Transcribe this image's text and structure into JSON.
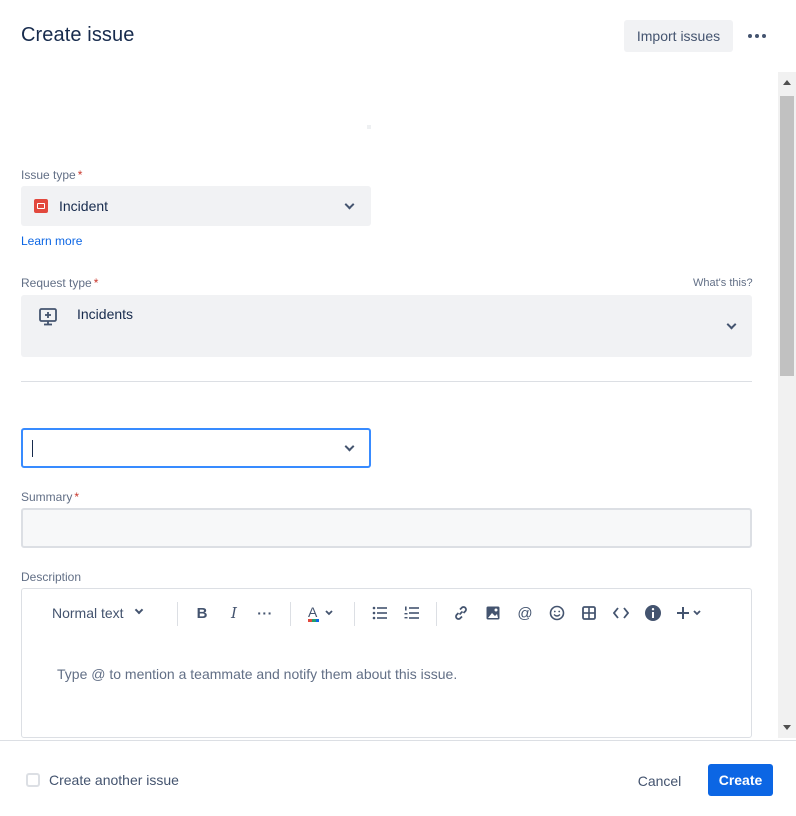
{
  "header": {
    "title": "Create issue",
    "import_label": "Import issues",
    "more_icon": "ellipsis-icon"
  },
  "issue_type": {
    "label": "Issue type",
    "required_mark": "*",
    "value": "Incident",
    "icon": "incident-icon",
    "learn_more": "Learn more"
  },
  "request_type": {
    "label": "Request type",
    "required_mark": "*",
    "whats_this": "What's this?",
    "value": "Incidents",
    "icon": "monitor-plus-icon"
  },
  "focused_select": {
    "value": ""
  },
  "summary": {
    "label": "Summary",
    "required_mark": "*",
    "value": ""
  },
  "description": {
    "label": "Description",
    "text_style": "Normal text",
    "placeholder": "Type @ to mention a teammate and notify them about this issue."
  },
  "footer": {
    "create_another_label": "Create another issue",
    "create_another_checked": false,
    "cancel_label": "Cancel",
    "create_label": "Create"
  },
  "colors": {
    "primary": "#0c66e4",
    "required": "#c9372c",
    "incident": "#e2483d",
    "focus_border": "#388bff"
  }
}
